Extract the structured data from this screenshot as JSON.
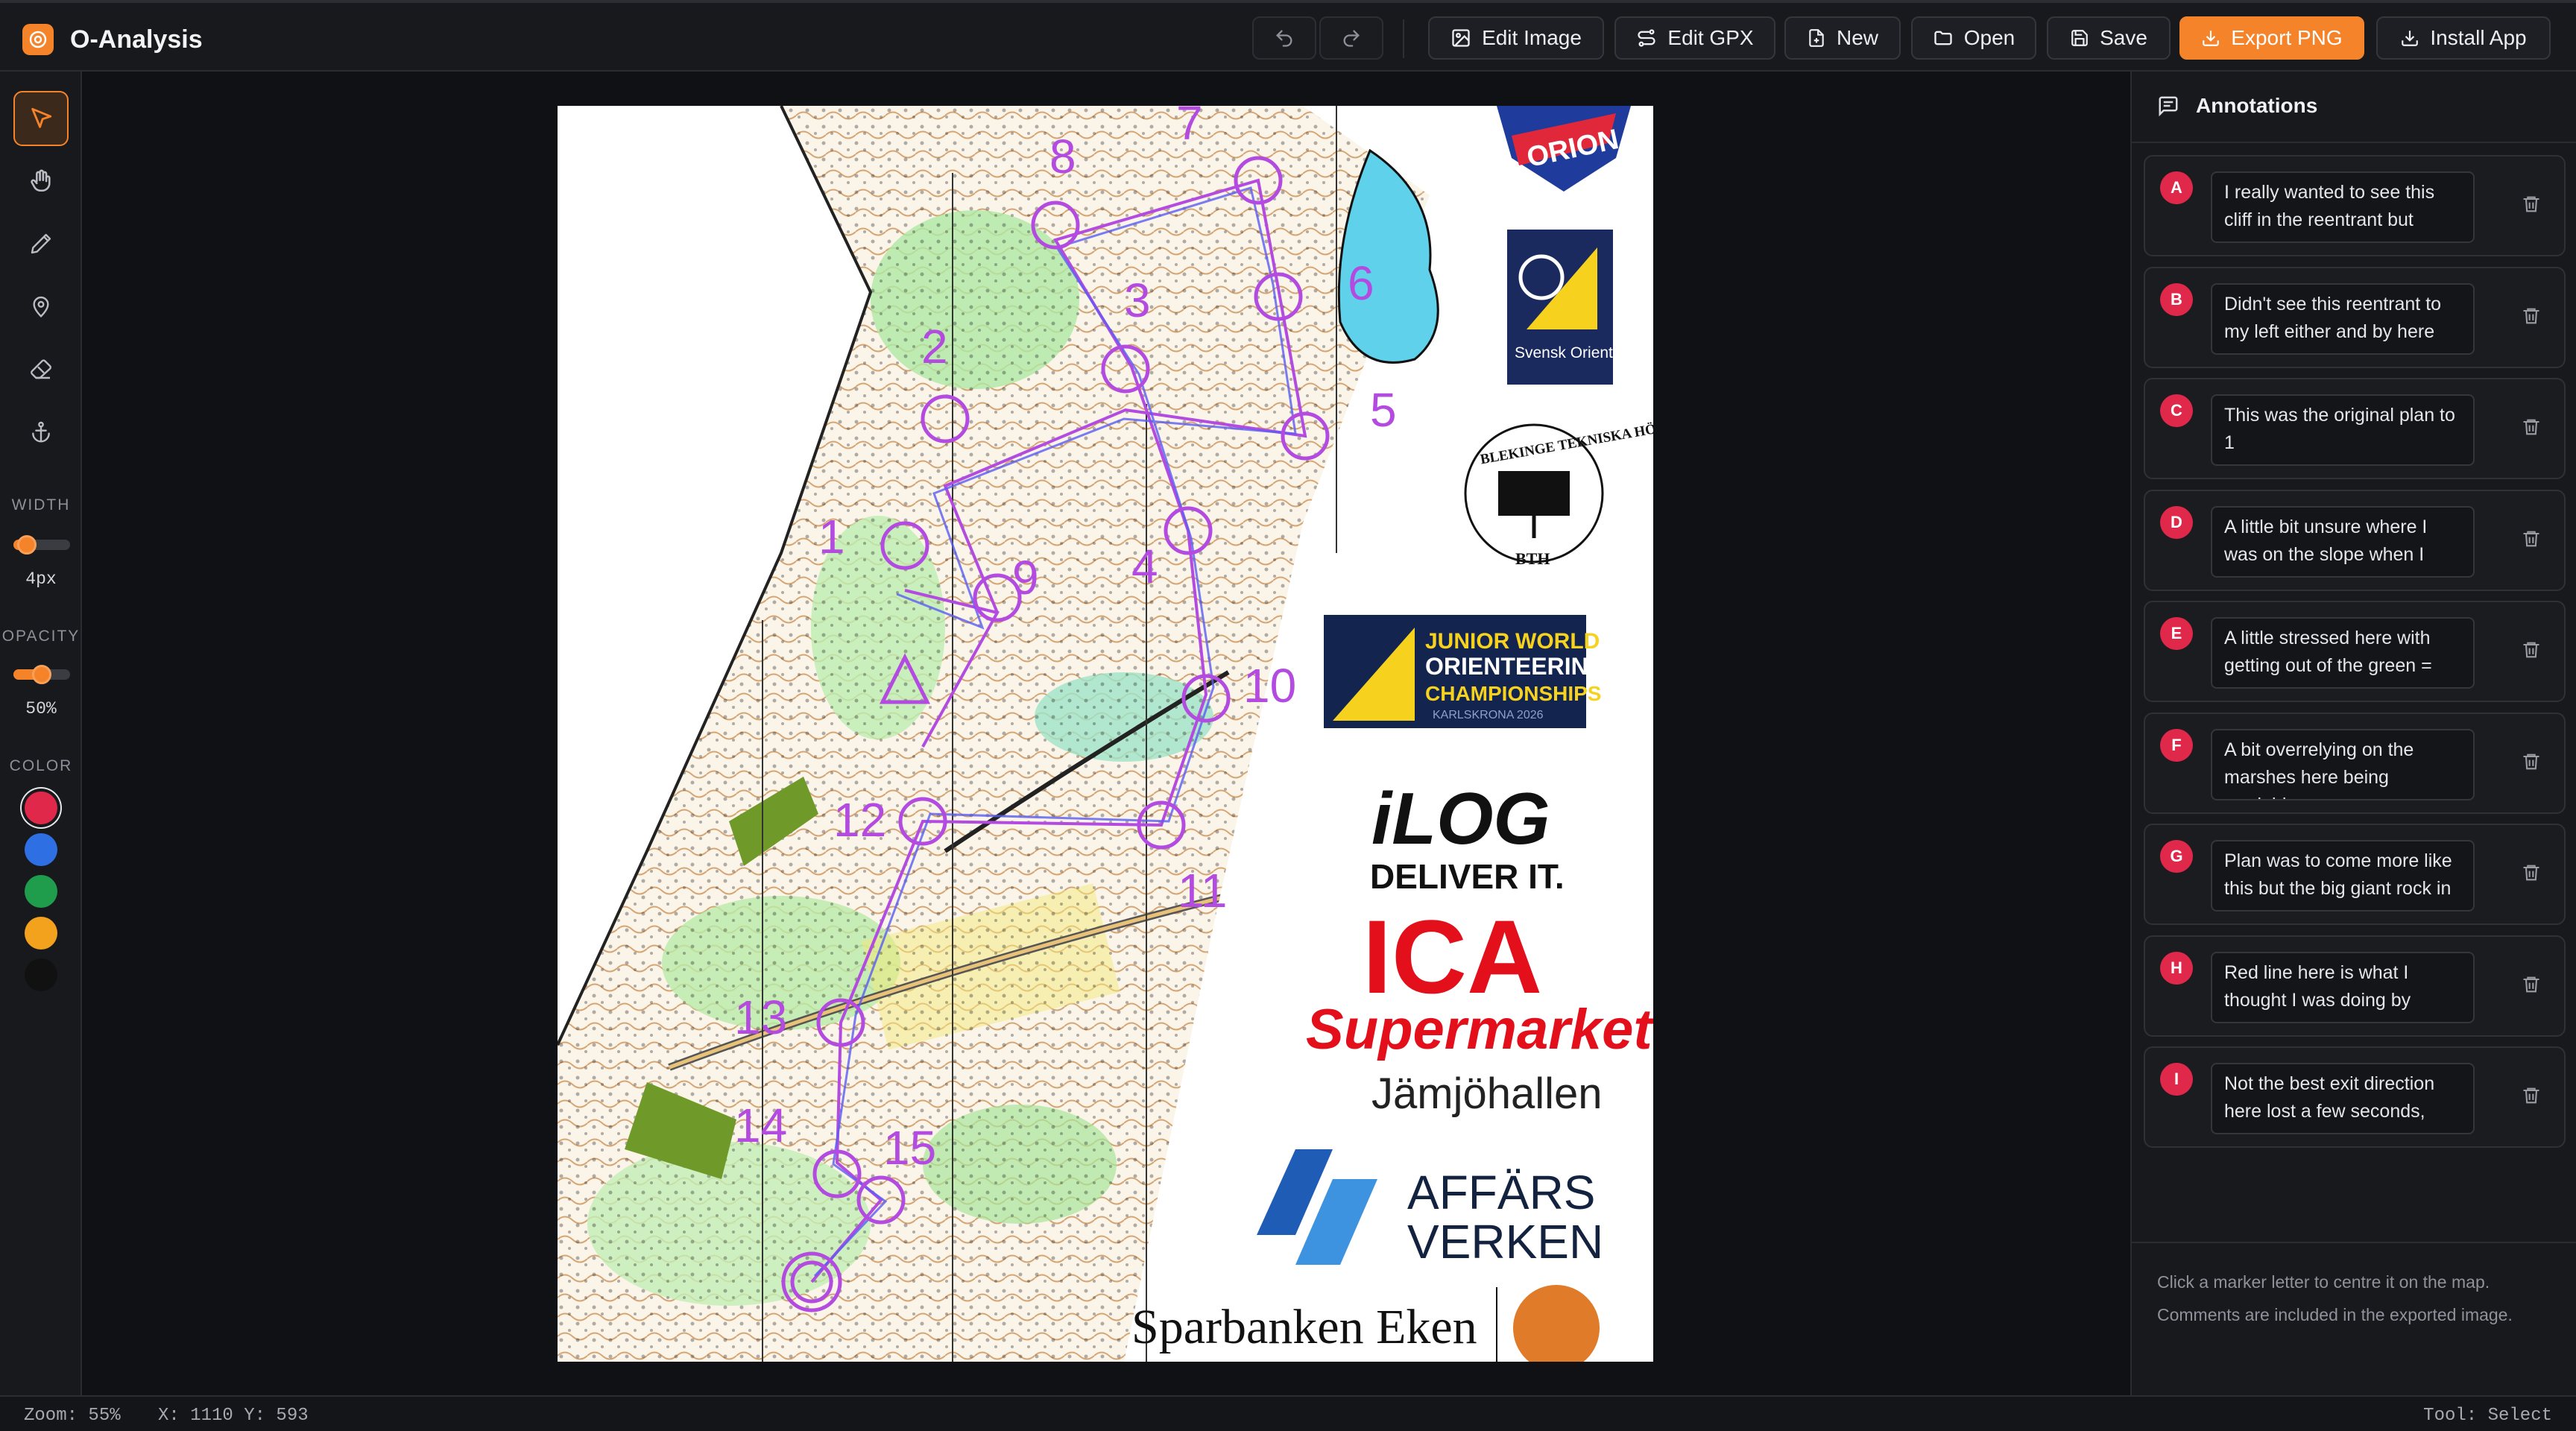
{
  "app": {
    "title": "O-Analysis"
  },
  "toolbar": {
    "edit_image": "Edit Image",
    "edit_gpx": "Edit GPX",
    "new": "New",
    "open": "Open",
    "save": "Save",
    "export_png": "Export PNG",
    "install_app": "Install App",
    "accent": "#f5832a"
  },
  "tools": [
    {
      "name": "select",
      "icon": "cursor-icon",
      "active": true
    },
    {
      "name": "pan",
      "icon": "hand-icon",
      "active": false
    },
    {
      "name": "draw",
      "icon": "pencil-icon",
      "active": false
    },
    {
      "name": "marker",
      "icon": "map-pin-icon",
      "active": false
    },
    {
      "name": "erase",
      "icon": "eraser-icon",
      "active": false
    },
    {
      "name": "anchor",
      "icon": "anchor-icon",
      "active": false
    }
  ],
  "settings": {
    "width_label": "WIDTH",
    "width_value": "4px",
    "width_level": 0.1,
    "opacity_label": "OPACITY",
    "opacity_value": "50%",
    "opacity_level": 0.5,
    "color_label": "COLOR",
    "colors": [
      "#e0284a",
      "#2f6fe4",
      "#1f9d4c",
      "#f2a21c",
      "#111111"
    ],
    "selected_color": "#e0284a"
  },
  "map": {
    "controls": [
      "1",
      "2",
      "3",
      "4",
      "5",
      "6",
      "7",
      "8",
      "9",
      "10",
      "11",
      "12",
      "13",
      "14",
      "15"
    ],
    "logos": {
      "club": "ORION",
      "federation": "Svensk Orientering",
      "university": "BLEKINGE TEKNISKA HÖGSKOLA",
      "university_short": "BTH",
      "event_line1": "JUNIOR",
      "event_line1b": "WORLD",
      "event_line2": "ORIENTEERING",
      "event_line3": "CHAMPIONSHIPS",
      "event_line4": "KARLSKRONA 2026",
      "ilog": "iLOG",
      "ilog_tag": "DELIVER IT.",
      "ica": "ICA",
      "ica_sub": "Supermarket",
      "ica_place": "Jämjöhallen",
      "affars1": "AFFÄRS",
      "affars2": "VERKEN",
      "bank": "Sparbanken Eken"
    }
  },
  "panel": {
    "title": "Annotations",
    "annotations": [
      {
        "letter": "A",
        "text": "I really wanted to see this cliff in the reentrant but"
      },
      {
        "letter": "B",
        "text": "Didn't see this reentrant to my left either and by here"
      },
      {
        "letter": "C",
        "text": "This was the original plan to 1"
      },
      {
        "letter": "D",
        "text": "A little bit unsure where I was on the slope when I"
      },
      {
        "letter": "E",
        "text": "A little stressed here with getting out of the green ="
      },
      {
        "letter": "F",
        "text": "A bit overrelying on the marshes here being readable"
      },
      {
        "letter": "G",
        "text": "Plan was to come more like this but the big giant rock in"
      },
      {
        "letter": "H",
        "text": "Red line here is what I thought I was doing by"
      },
      {
        "letter": "I",
        "text": "Not the best exit direction here lost a few seconds,"
      }
    ],
    "footer": "Click a marker letter to centre it on the map. Comments are included in the exported image."
  },
  "status": {
    "zoom": "Zoom: 55%",
    "coords": "X: 1110 Y: 593",
    "tool": "Tool: Select"
  }
}
